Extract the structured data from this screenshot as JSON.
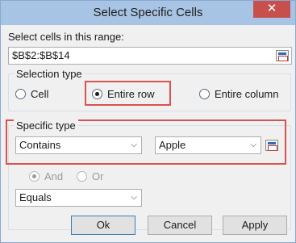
{
  "window": {
    "title": "Select Specific Cells",
    "close_glyph": "✕"
  },
  "range": {
    "label": "Select cells in this range:",
    "value": "$B$2:$B$14",
    "button_icon": "range-select-icon"
  },
  "selection_type": {
    "title": "Selection type",
    "options": {
      "cell": "Cell",
      "entire_row": "Entire row",
      "entire_column": "Entire column"
    },
    "selected": "Entire row"
  },
  "specific_type": {
    "title": "Specific type",
    "condition1": "Contains",
    "value1": "Apple",
    "and_label": "And",
    "or_label": "Or",
    "condition2": "Equals",
    "value2": ""
  },
  "buttons": {
    "ok": "Ok",
    "cancel": "Cancel",
    "apply": "Apply"
  },
  "colors": {
    "titlebar": "#a8c4e4",
    "close": "#c7504c",
    "highlight": "#d9534f"
  }
}
